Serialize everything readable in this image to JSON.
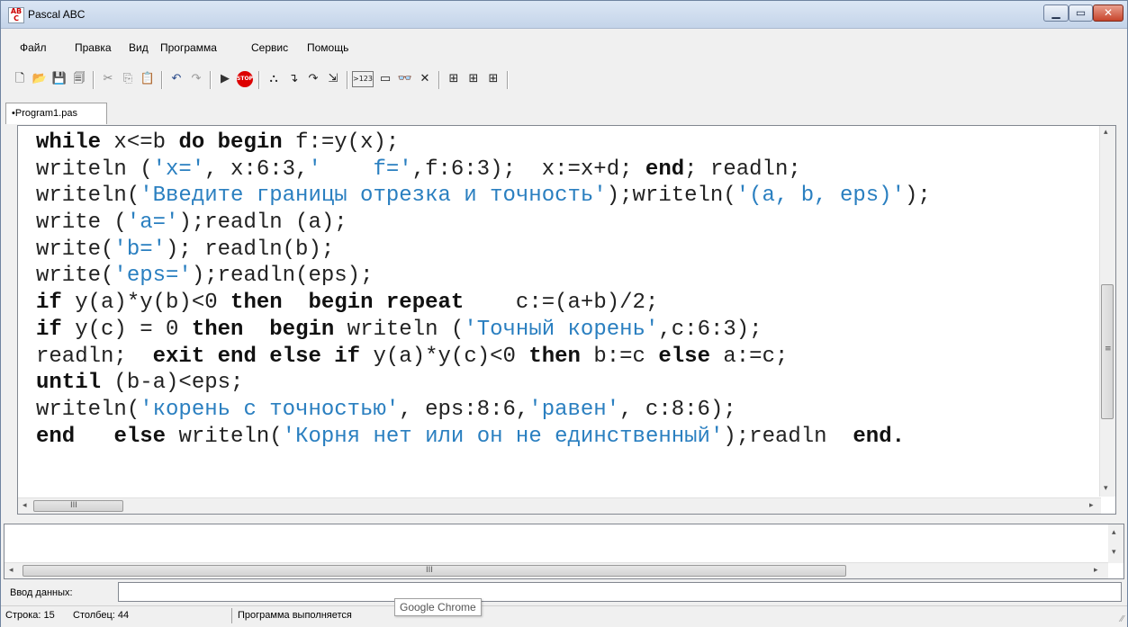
{
  "window": {
    "title": "Pascal ABC",
    "icon": "AB C",
    "min_icon": "▁",
    "max_icon": "▭",
    "close_icon": "✕"
  },
  "menu": [
    "Файл",
    "Правка",
    "Вид",
    "Программа",
    "Сервис",
    "Помощь"
  ],
  "toolbar": {
    "new": "🗋",
    "open": "📂",
    "save": "💾",
    "save_all": "🗐",
    "cut": "✂",
    "copy": "⎘",
    "paste": "📋",
    "undo": "↶",
    "redo": "↷",
    "run": "▶",
    "stop": "STOP",
    "debug1": "⛬",
    "step_into": "↴",
    "step_over": "↷",
    "step_out": "⇲",
    "watch": ">123",
    "window": "▭",
    "glasses": "👓",
    "close": "✕",
    "t1": "⊞",
    "t2": "⊞",
    "t3": "⊞"
  },
  "tab": {
    "label": "•Program1.pas"
  },
  "code_lines": [
    [
      {
        "t": "while",
        "k": "kw"
      },
      {
        "t": " x<=b "
      },
      {
        "t": "do",
        "k": "kw"
      },
      {
        "t": " "
      },
      {
        "t": "begin",
        "k": "kw"
      },
      {
        "t": " f:=y(x);"
      }
    ],
    [
      {
        "t": "writeln ("
      },
      {
        "t": "'x='",
        "k": "str"
      },
      {
        "t": ", x:6:3,"
      },
      {
        "t": "'    f='",
        "k": "str"
      },
      {
        "t": ",f:6:3);  x:=x+d; "
      },
      {
        "t": "end",
        "k": "kw"
      },
      {
        "t": "; readln;"
      }
    ],
    [
      {
        "t": "writeln("
      },
      {
        "t": "'Введите границы отрезка и точность'",
        "k": "str"
      },
      {
        "t": ");writeln("
      },
      {
        "t": "'(a, b, eps)'",
        "k": "str"
      },
      {
        "t": ");"
      }
    ],
    [
      {
        "t": "write ("
      },
      {
        "t": "'a='",
        "k": "str"
      },
      {
        "t": ");readln (a);"
      }
    ],
    [
      {
        "t": "write("
      },
      {
        "t": "'b='",
        "k": "str"
      },
      {
        "t": "); readln(b);"
      }
    ],
    [
      {
        "t": "write("
      },
      {
        "t": "'eps='",
        "k": "str"
      },
      {
        "t": ");readln(eps);"
      }
    ],
    [
      {
        "t": "if",
        "k": "kw"
      },
      {
        "t": " y(a)*y(b)<0 "
      },
      {
        "t": "then",
        "k": "kw"
      },
      {
        "t": "  "
      },
      {
        "t": "begin",
        "k": "kw"
      },
      {
        "t": " "
      },
      {
        "t": "repeat",
        "k": "kw"
      },
      {
        "t": "    c:=(a+b)/2;"
      }
    ],
    [
      {
        "t": "if",
        "k": "kw"
      },
      {
        "t": " y(c) = 0 "
      },
      {
        "t": "then",
        "k": "kw"
      },
      {
        "t": "  "
      },
      {
        "t": "begin",
        "k": "kw"
      },
      {
        "t": " writeln ("
      },
      {
        "t": "'Точный корень'",
        "k": "str"
      },
      {
        "t": ",c:6:3);"
      }
    ],
    [
      {
        "t": "readln;  "
      },
      {
        "t": "exit",
        "k": "kw"
      },
      {
        "t": " "
      },
      {
        "t": "end",
        "k": "kw"
      },
      {
        "t": " "
      },
      {
        "t": "else",
        "k": "kw"
      },
      {
        "t": " "
      },
      {
        "t": "if",
        "k": "kw"
      },
      {
        "t": " y(a)*y(c)<0 "
      },
      {
        "t": "then",
        "k": "kw"
      },
      {
        "t": " b:=c "
      },
      {
        "t": "else",
        "k": "kw"
      },
      {
        "t": " a:=c;"
      }
    ],
    [
      {
        "t": "until",
        "k": "kw"
      },
      {
        "t": " (b-a)<eps;"
      }
    ],
    [
      {
        "t": "writeln("
      },
      {
        "t": "'корень с точностью'",
        "k": "str"
      },
      {
        "t": ", eps:8:6,"
      },
      {
        "t": "'равен'",
        "k": "str"
      },
      {
        "t": ", c:8:6);"
      }
    ],
    [
      {
        "t": "end",
        "k": "kw"
      },
      {
        "t": "   "
      },
      {
        "t": "else",
        "k": "kw"
      },
      {
        "t": " writeln("
      },
      {
        "t": "'Корня нет или он не единственный'",
        "k": "str"
      },
      {
        "t": ");readln  "
      },
      {
        "t": "end.",
        "k": "kw"
      }
    ]
  ],
  "scroll": {
    "thumb_marker": "≡",
    "h_marker": "III",
    "left": "◂",
    "right": "▸",
    "up": "▴",
    "down": "▾"
  },
  "input": {
    "label": "Ввод данных:",
    "value": ""
  },
  "status": {
    "line": "Строка: 15",
    "column": "Столбец: 44",
    "message": "Программа выполняется"
  },
  "tooltip": "Google Chrome",
  "grip": "⁄⁄"
}
